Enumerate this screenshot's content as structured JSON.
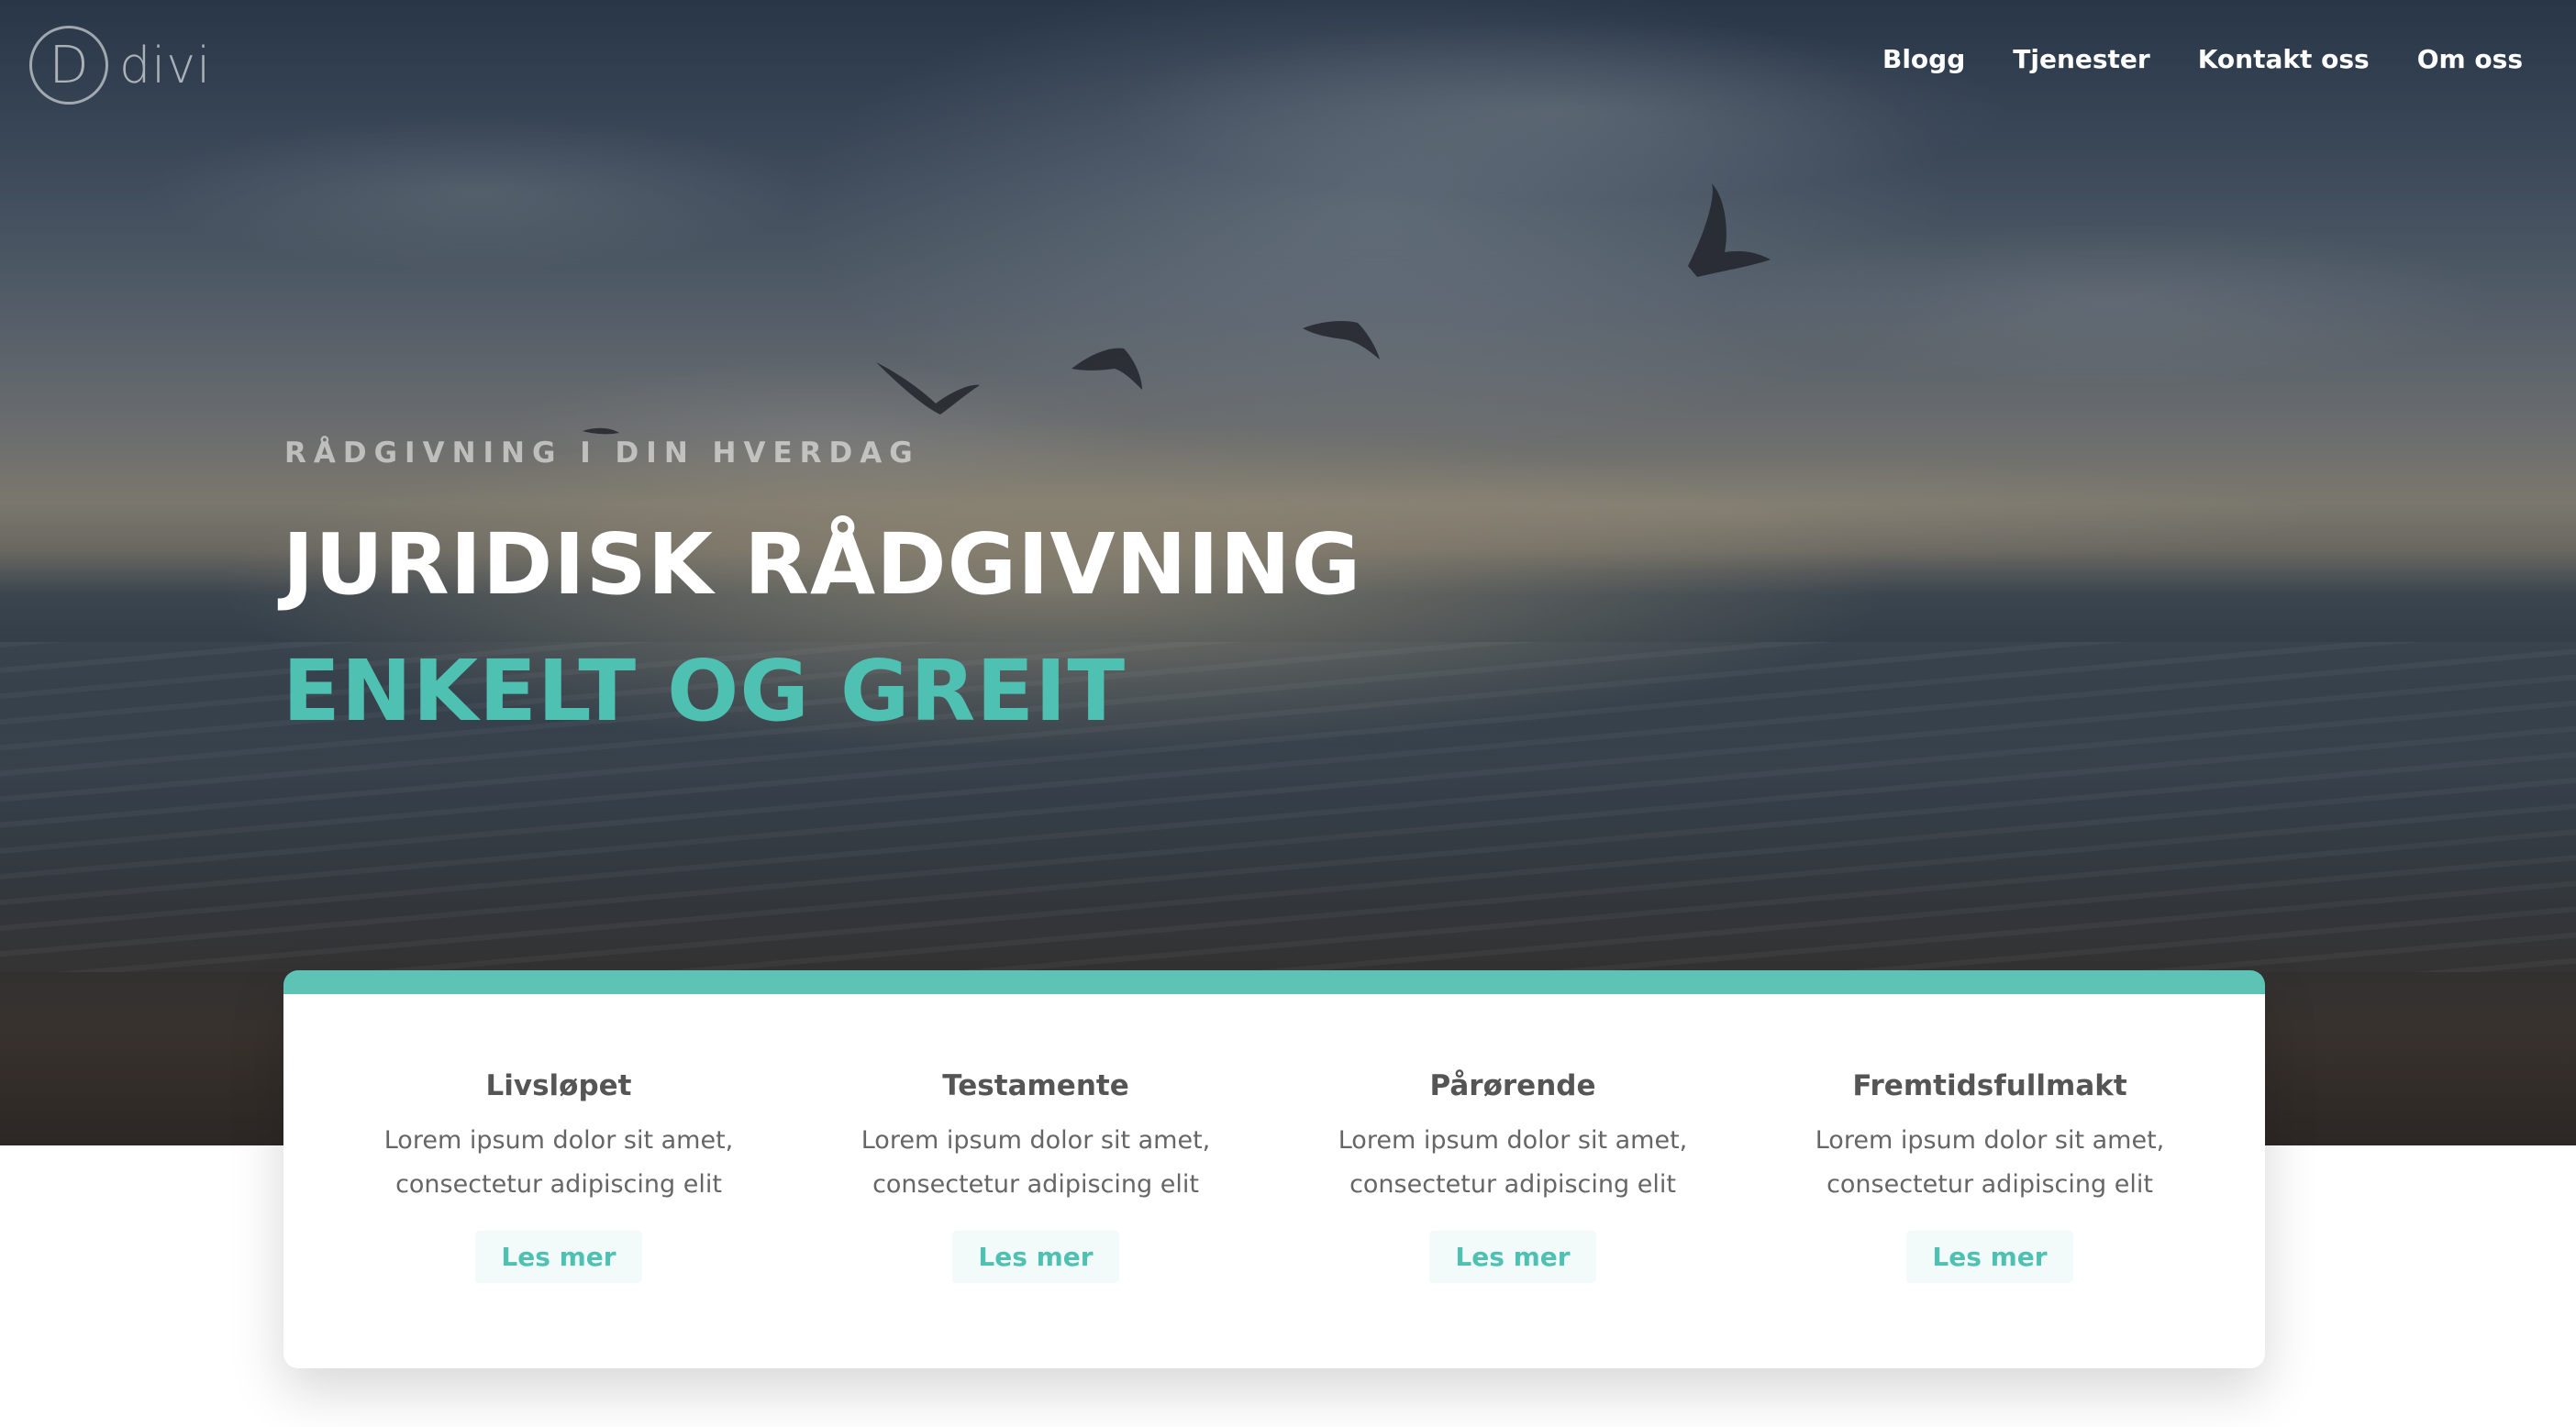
{
  "brand": {
    "logo_letter": "D",
    "logo_word": "divi"
  },
  "nav": {
    "items": [
      {
        "label": "Blogg"
      },
      {
        "label": "Tjenester"
      },
      {
        "label": "Kontakt oss"
      },
      {
        "label": "Om oss"
      }
    ]
  },
  "hero": {
    "eyebrow": "RÅDGIVNING I DIN HVERDAG",
    "title_line1": "JURIDISK RÅDGIVNING",
    "title_line2": "ENKELT OG GREIT"
  },
  "services": [
    {
      "title": "Livsløpet",
      "text_line1": "Lorem ipsum dolor sit amet,",
      "text_line2": "consectetur adipiscing elit",
      "button": "Les mer"
    },
    {
      "title": "Testamente",
      "text_line1": "Lorem ipsum dolor sit amet,",
      "text_line2": "consectetur adipiscing elit",
      "button": "Les mer"
    },
    {
      "title": "Pårørende",
      "text_line1": "Lorem ipsum dolor sit amet,",
      "text_line2": "consectetur adipiscing elit",
      "button": "Les mer"
    },
    {
      "title": "Fremtidsfullmakt",
      "text_line1": "Lorem ipsum dolor sit amet,",
      "text_line2": "consectetur adipiscing elit",
      "button": "Les mer"
    }
  ],
  "colors": {
    "accent": "#4fc1b2",
    "card_border": "#5cc3b5",
    "heading_text": "#555555",
    "body_text": "#666666"
  }
}
